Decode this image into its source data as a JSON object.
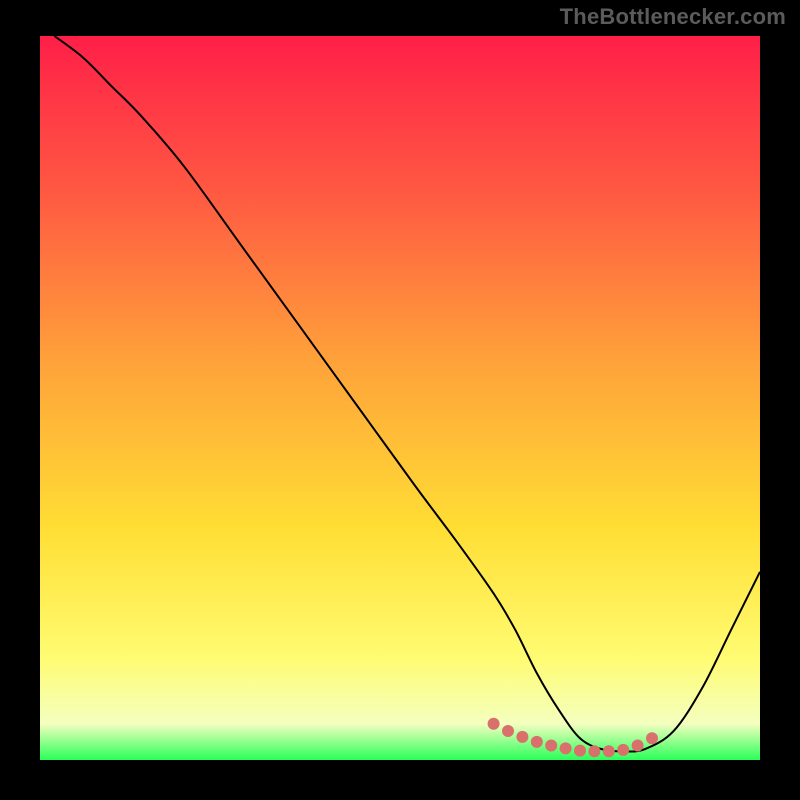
{
  "attribution": "TheBottlenecker.com",
  "chart_data": {
    "type": "line",
    "title": "",
    "xlabel": "",
    "ylabel": "",
    "xlim": [
      0,
      100
    ],
    "ylim": [
      0,
      100
    ],
    "background_gradient": {
      "stops": [
        {
          "offset": 0,
          "color": "#ff1f48"
        },
        {
          "offset": 22,
          "color": "#ff5a42"
        },
        {
          "offset": 45,
          "color": "#ffa23a"
        },
        {
          "offset": 68,
          "color": "#ffde34"
        },
        {
          "offset": 86,
          "color": "#fffc72"
        },
        {
          "offset": 95,
          "color": "#f4ffbf"
        },
        {
          "offset": 100,
          "color": "#2aff59"
        }
      ]
    },
    "series": [
      {
        "name": "bottleneck-curve",
        "color": "#000000",
        "stroke_width": 2,
        "x": [
          2,
          6,
          10,
          14,
          20,
          28,
          36,
          44,
          52,
          58,
          63,
          66,
          69,
          72,
          75,
          78,
          81,
          84,
          88,
          92,
          96,
          100
        ],
        "y": [
          100,
          97,
          93,
          89,
          82,
          71,
          60,
          49,
          38,
          30,
          23,
          18,
          12,
          7,
          3,
          1.5,
          1.2,
          1.5,
          4,
          10,
          18,
          26
        ]
      }
    ],
    "markers": {
      "name": "highlight-dots",
      "color": "#d9706c",
      "radius": 6,
      "x": [
        63,
        65,
        67,
        69,
        71,
        73,
        75,
        77,
        79,
        81,
        83,
        85
      ],
      "y": [
        5,
        4,
        3.2,
        2.5,
        2,
        1.6,
        1.3,
        1.2,
        1.2,
        1.4,
        2,
        3
      ]
    }
  }
}
